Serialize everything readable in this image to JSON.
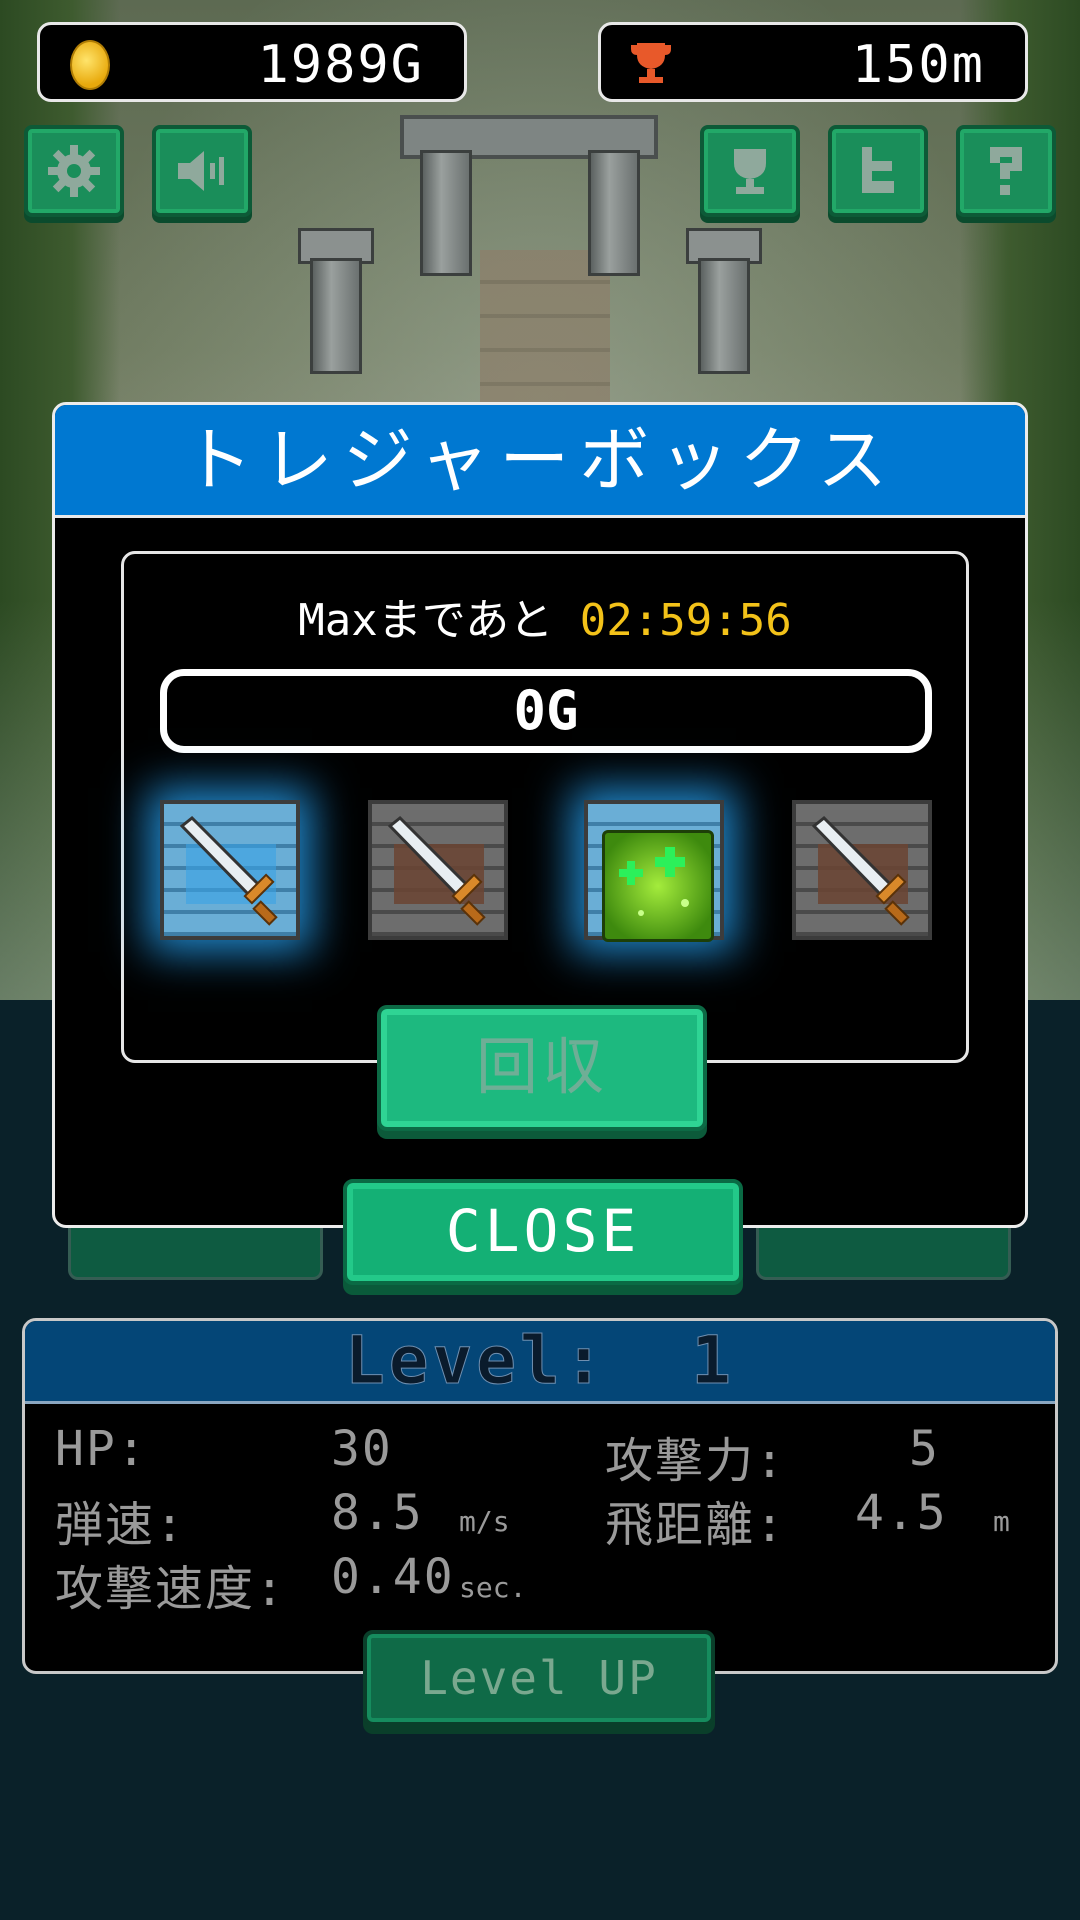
{
  "hud": {
    "gold": "1989G",
    "distance": "150m"
  },
  "top_buttons": {
    "settings": "gear-icon",
    "sound": "speaker-icon",
    "ranking": "trophy-icon",
    "twitter": "twitter-icon",
    "help": "help-icon"
  },
  "modal": {
    "title": "トレジャーボックス",
    "timer_prefix": "Maxまであと",
    "timer_value": "02:59:56",
    "gold_amount": "0G",
    "slots": [
      {
        "item": "sword-icon",
        "highlighted": true
      },
      {
        "item": "sword-icon",
        "highlighted": false
      },
      {
        "item": "heal-herb-icon",
        "highlighted": true
      },
      {
        "item": "sword-icon",
        "highlighted": false
      }
    ],
    "collect_label": "回収",
    "close_label": "CLOSE"
  },
  "stats": {
    "level_label": "Level:",
    "level_value": "1",
    "hp_label": "HP:",
    "hp_value": "30",
    "attack_label": "攻撃力:",
    "attack_value": "5",
    "bullet_speed_label": "弾速:",
    "bullet_speed_value": "8.5",
    "bullet_speed_unit": "m/s",
    "range_label": "飛距離:",
    "range_value": "4.5",
    "range_unit": "m",
    "attack_speed_label": "攻撃速度:",
    "attack_speed_value": "0.40",
    "attack_speed_unit": "sec.",
    "levelup_label": "Level UP"
  },
  "colors": {
    "accent_blue": "#0078d1",
    "button_green": "#14b075",
    "timer_yellow": "#f3c219",
    "stats_header": "#044677"
  }
}
